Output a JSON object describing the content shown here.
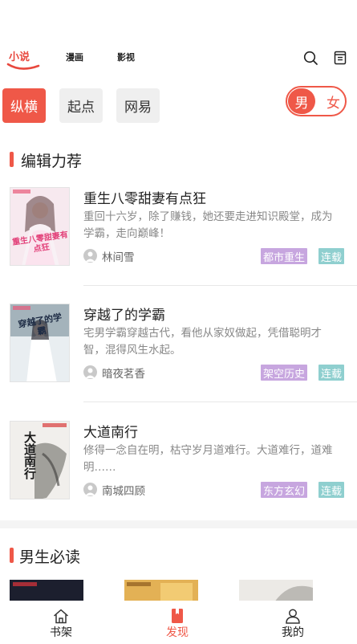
{
  "topnav": {
    "tabs": [
      {
        "label": "小说",
        "active": true
      },
      {
        "label": "漫画",
        "active": false
      },
      {
        "label": "影视",
        "active": false
      }
    ],
    "icons": [
      "search-icon",
      "bookshelf-list-icon"
    ]
  },
  "sources": {
    "chips": [
      {
        "label": "纵横",
        "active": true
      },
      {
        "label": "起点",
        "active": false
      },
      {
        "label": "网易",
        "active": false
      }
    ],
    "gender": {
      "male": "男",
      "female": "女",
      "selected": "男"
    }
  },
  "editor_picks": {
    "title": "编辑力荐",
    "books": [
      {
        "title": "重生八零甜妻有点狂",
        "description": "重回十六岁，除了赚钱，她还要走进知识殿堂，成为学霸，走向巅峰！",
        "author": "林间雪",
        "genre": "都市重生",
        "status": "连载",
        "cover_text": "重生八零甜妻有点狂"
      },
      {
        "title": "穿越了的学霸",
        "description": "宅男学霸穿越古代，看他从家奴做起，凭借聪明才智，混得风生水起。",
        "author": "暗夜茗香",
        "genre": "架空历史",
        "status": "连载",
        "cover_text": "穿越了的学霸"
      },
      {
        "title": "大道南行",
        "description": "修得一念自在明，枯守岁月道难行。大道难行，道难明……",
        "author": "南城四顾",
        "genre": "东方玄幻",
        "status": "连载",
        "cover_text": "大道南行"
      }
    ]
  },
  "male_must_read": {
    "title": "男生必读"
  },
  "tabbar": {
    "items": [
      {
        "label": "书架",
        "icon": "home-icon",
        "active": false
      },
      {
        "label": "发现",
        "icon": "bookmark-book-icon",
        "active": true
      },
      {
        "label": "我的",
        "icon": "user-icon",
        "active": false
      }
    ]
  },
  "colors": {
    "accent": "#ef5848",
    "genre_badge": "#c7a6df",
    "status_badge": "#8fcfcf"
  }
}
